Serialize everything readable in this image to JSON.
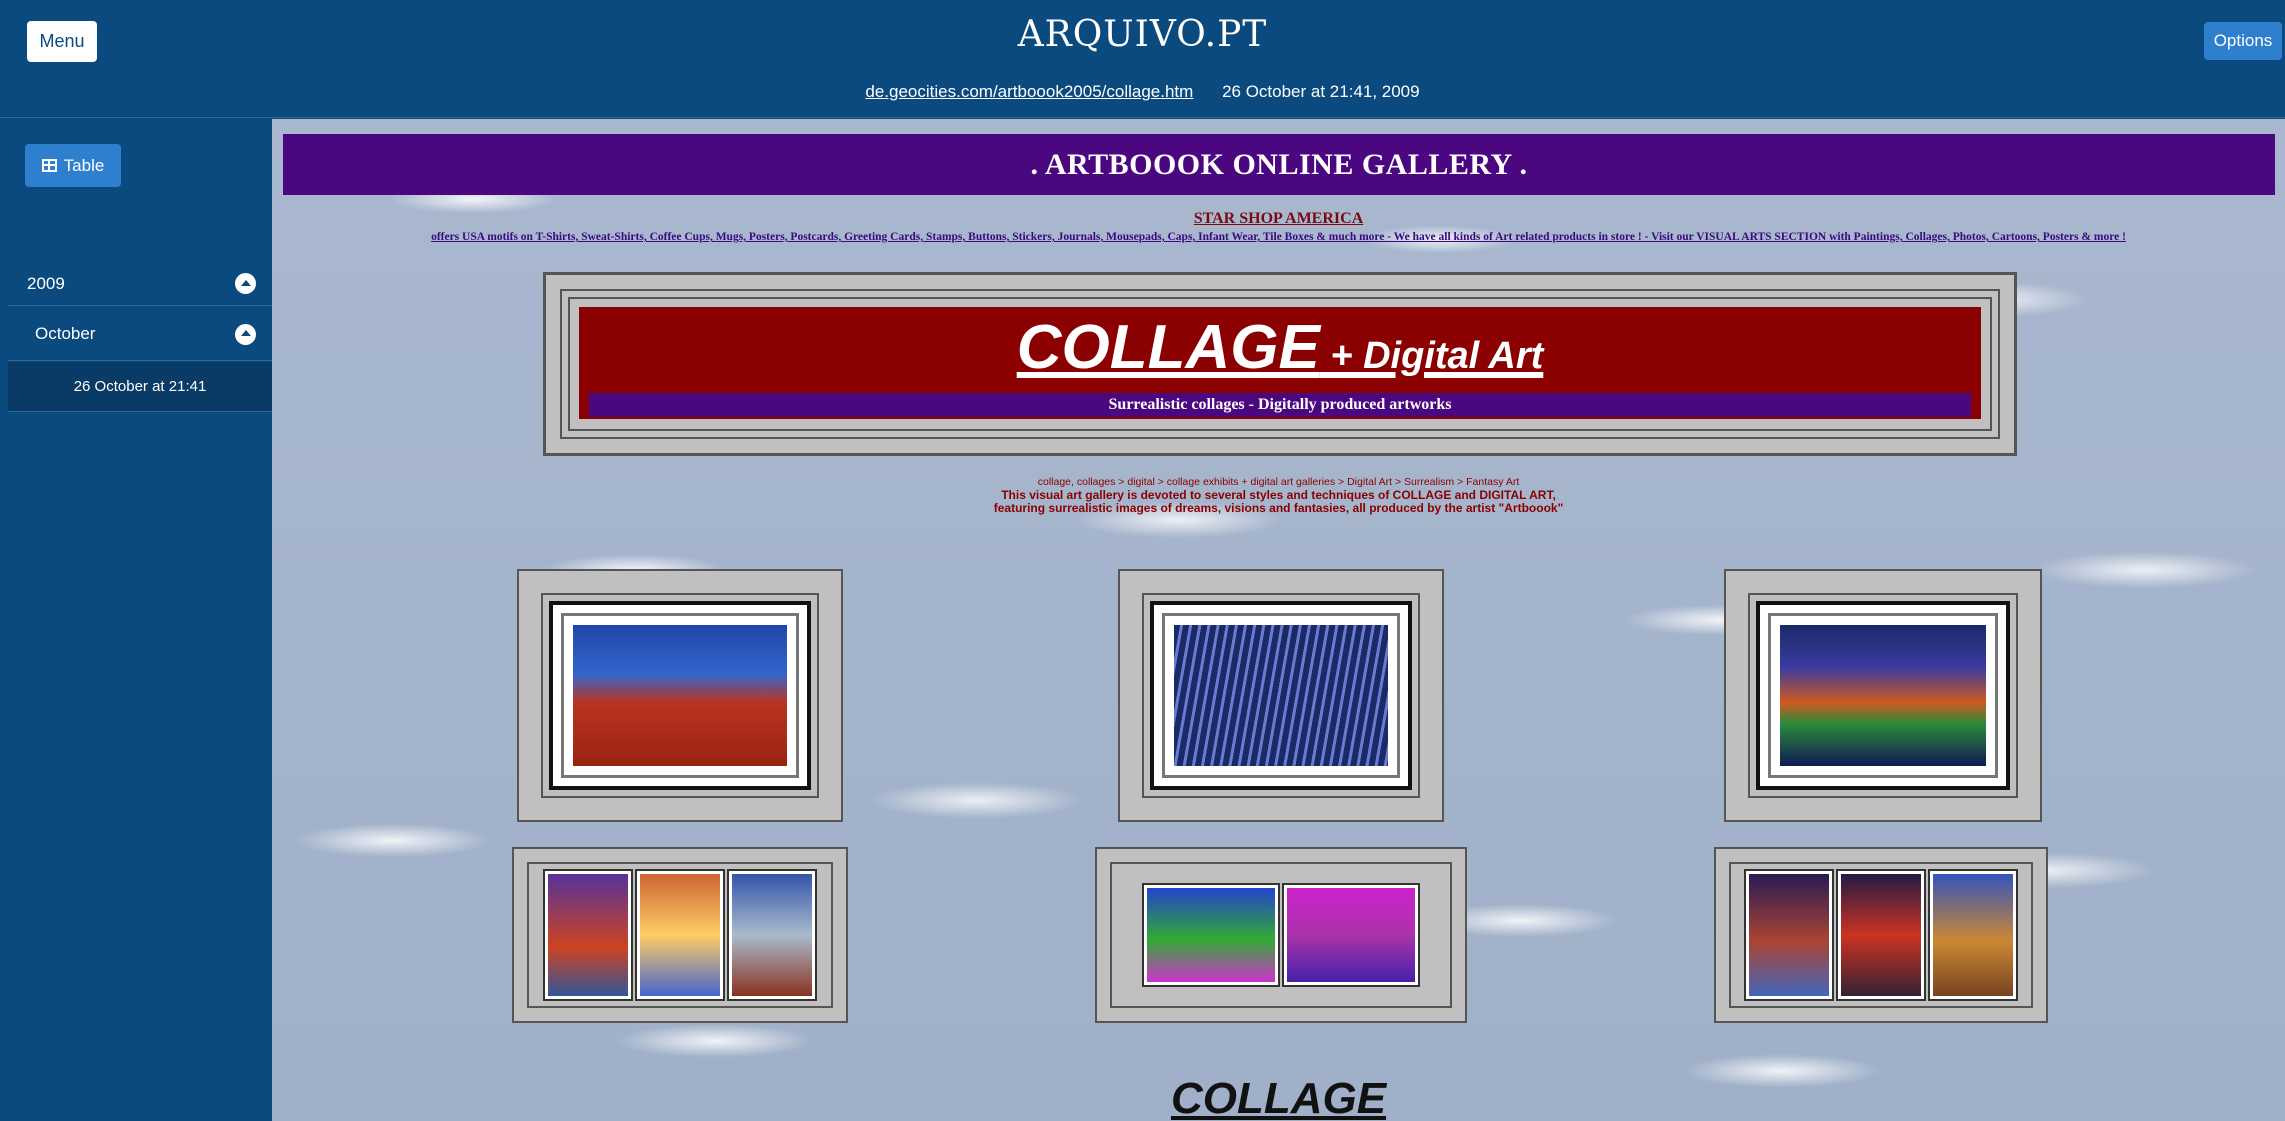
{
  "header": {
    "menu_label": "Menu",
    "logo": "ARQUIVO.PT",
    "url": "de.geocities.com/artboook2005/collage.htm",
    "timestamp": "26 October at 21:41, 2009",
    "options_label": "Options"
  },
  "sidebar": {
    "table_label": "Table",
    "year": "2009",
    "month": "October",
    "day": "26 October at 21:41"
  },
  "archived_page": {
    "banner": ". ARTBOOOK ONLINE GALLERY .",
    "star_link": "STAR SHOP AMERICA",
    "star_sub": "offers USA motifs on T-Shirts, Sweat-Shirts, Coffee Cups, Mugs, Posters, Postcards, Greeting Cards, Stamps, Buttons, Stickers, Journals, Mousepads, Caps, Infant Wear, Tile Boxes & much more - We have all kinds of Art related products in store ! - Visit our VISUAL ARTS SECTION with Paintings, Collages, Photos, Cartoons, Posters & more !",
    "title_main": "COLLAGE",
    "title_plus": " + Digital Art",
    "title_strip": "Surrealistic collages - Digitally produced artworks",
    "desc_line1": "collage, collages > digital > collage exhibits + digital art galleries > Digital Art > Surrealism > Fantasy Art",
    "desc_line2": "This visual art gallery is devoted to several styles and techniques of COLLAGE and DIGITAL ART,",
    "desc_line3": "featuring surrealistic images of dreams, visions and fantasies, all produced by the artist \"Artboook\"",
    "bottom_title": "COLLAGE"
  },
  "colors": {
    "archive_blue": "#0b4a7f",
    "button_blue": "#2f7fcf",
    "banner_purple": "#4b0780",
    "title_red": "#8b0000"
  }
}
